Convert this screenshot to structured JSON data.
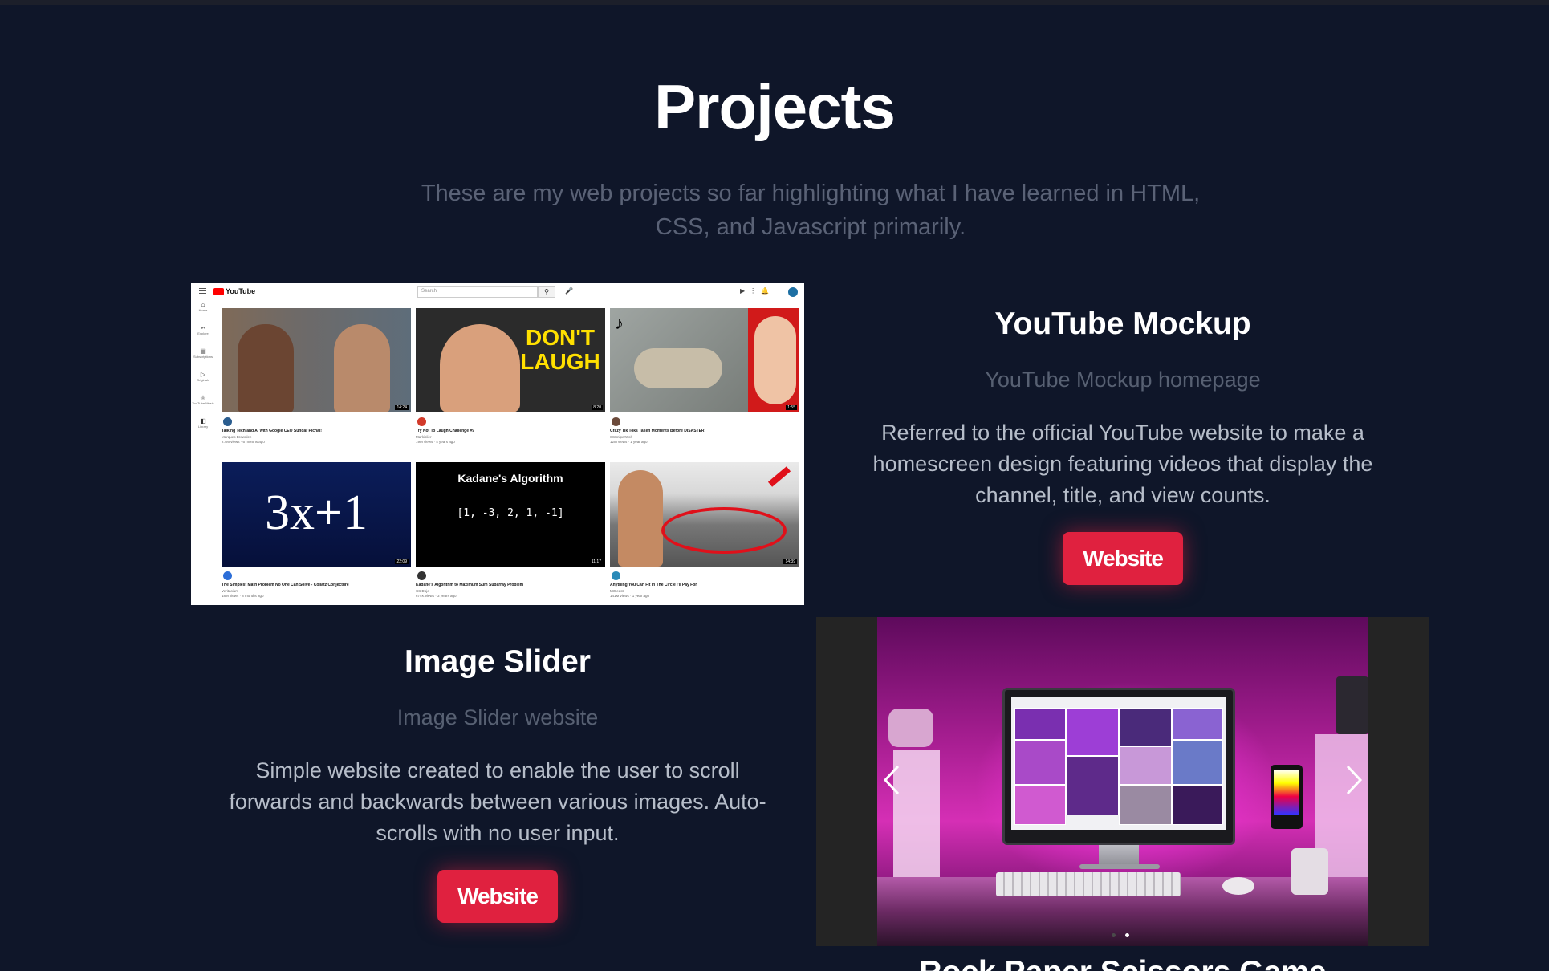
{
  "page": {
    "title": "Projects",
    "subtitle": "These are my web projects so far highlighting what I have learned in HTML, CSS, and Javascript primarily."
  },
  "projects": [
    {
      "title": "YouTube Mockup",
      "subtitle": "YouTube Mockup homepage",
      "description": "Referred to the official YouTube website to make a homescreen design featuring videos that display the channel, title, and view counts.",
      "button": "Website"
    },
    {
      "title": "Image Slider",
      "subtitle": "Image Slider website",
      "description": "Simple website created to enable the user to scroll forwards and backwards between various images. Auto-scrolls with no user input.",
      "button": "Website"
    },
    {
      "title": "Rock Paper Scissors Game",
      "subtitle": "",
      "description": "",
      "button": ""
    }
  ],
  "youtube_mock": {
    "logo": "YouTube",
    "search_placeholder": "Search",
    "sidebar": [
      "Home",
      "Explore",
      "Subscriptions",
      "Originals",
      "YouTube Music",
      "Library"
    ],
    "videos": [
      {
        "title": "Talking Tech and AI with Google CEO Sundar Pichai!",
        "channel": "Marques Brownlee",
        "views": "2.4M views · 6 months ago",
        "duration": "14:24",
        "channel_color": "#2a5d8f",
        "thumb_color": "#6a6f75"
      },
      {
        "title": "Try Not To Laugh Challenge #9",
        "channel": "Markiplier",
        "views": "19M views · 4 years ago",
        "duration": "8:20",
        "channel_color": "#d23a2a",
        "thumb_color": "#2b2b2b"
      },
      {
        "title": "Crazy Tik Toks Taken Moments Before DISASTER",
        "channel": "SSSniperWolf",
        "views": "12M views · 1 year ago",
        "duration": "1:55",
        "channel_color": "#6b4a3a",
        "thumb_color": "#8a8f8c"
      },
      {
        "title": "The Simplest Math Problem No One Can Solve - Collatz Conjecture",
        "channel": "Veritasium",
        "views": "18M views · 8 months ago",
        "duration": "22:09",
        "channel_color": "#2c6ed8",
        "thumb_color": "#10164a"
      },
      {
        "title": "Kadane's Algorithm to Maximum Sum Subarray Problem",
        "channel": "CS Dojo",
        "views": "674K views · 3 years ago",
        "duration": "11:17",
        "channel_color": "#333333",
        "thumb_color": "#000000"
      },
      {
        "title": "Anything You Can Fit In The Circle I'll Pay For",
        "channel": "MrBeast",
        "views": "141M views · 1 year ago",
        "duration": "14:39",
        "channel_color": "#2a8ab8",
        "thumb_color": "#d9d9d9"
      }
    ],
    "thumb_text": {
      "laugh": "DON'T LAUGH",
      "collatz": "3x+1",
      "kadane": "Kadane's Algorithm",
      "kadane_array": "[1, -3, 2, 1, -1]"
    }
  },
  "slider": {
    "prev_icon": "chevron-left-icon",
    "next_icon": "chevron-right-icon",
    "active_index": 1,
    "dot_count": 2
  },
  "colors": {
    "background": "#0f1629",
    "accent": "#e0213f",
    "muted": "#576072"
  }
}
